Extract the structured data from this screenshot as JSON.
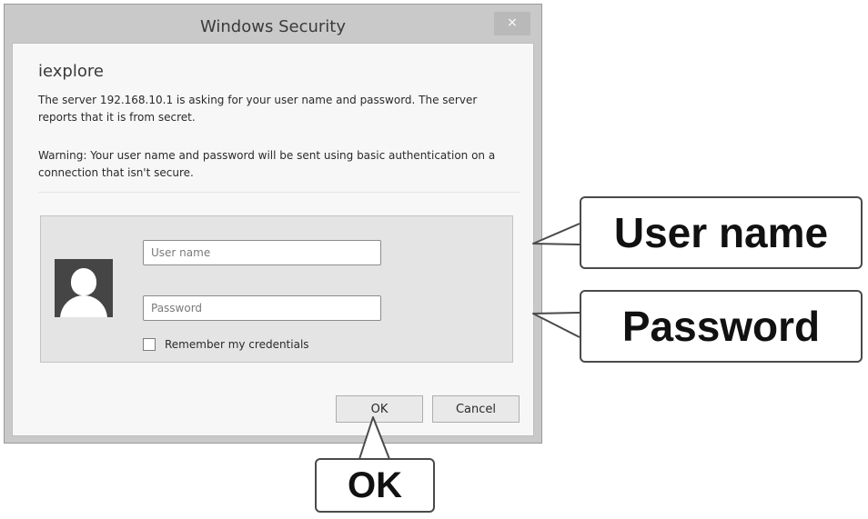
{
  "window": {
    "title": "Windows Security",
    "close_glyph": "×"
  },
  "dialog": {
    "app_name": "iexplore",
    "message": "The server 192.168.10.1 is asking for your user name and password. The server reports that it is from secret.",
    "warning": "Warning: Your user name and password will be sent using basic authentication on a connection that isn't secure."
  },
  "credentials": {
    "avatar_icon": "user-avatar-icon",
    "username": {
      "placeholder": "User name",
      "value": ""
    },
    "password": {
      "placeholder": "Password",
      "value": ""
    },
    "remember_label": "Remember my credentials",
    "remember_checked": false
  },
  "buttons": {
    "ok": "OK",
    "cancel": "Cancel"
  },
  "callouts": {
    "user_name": "User name",
    "password": "Password",
    "ok": "OK"
  }
}
